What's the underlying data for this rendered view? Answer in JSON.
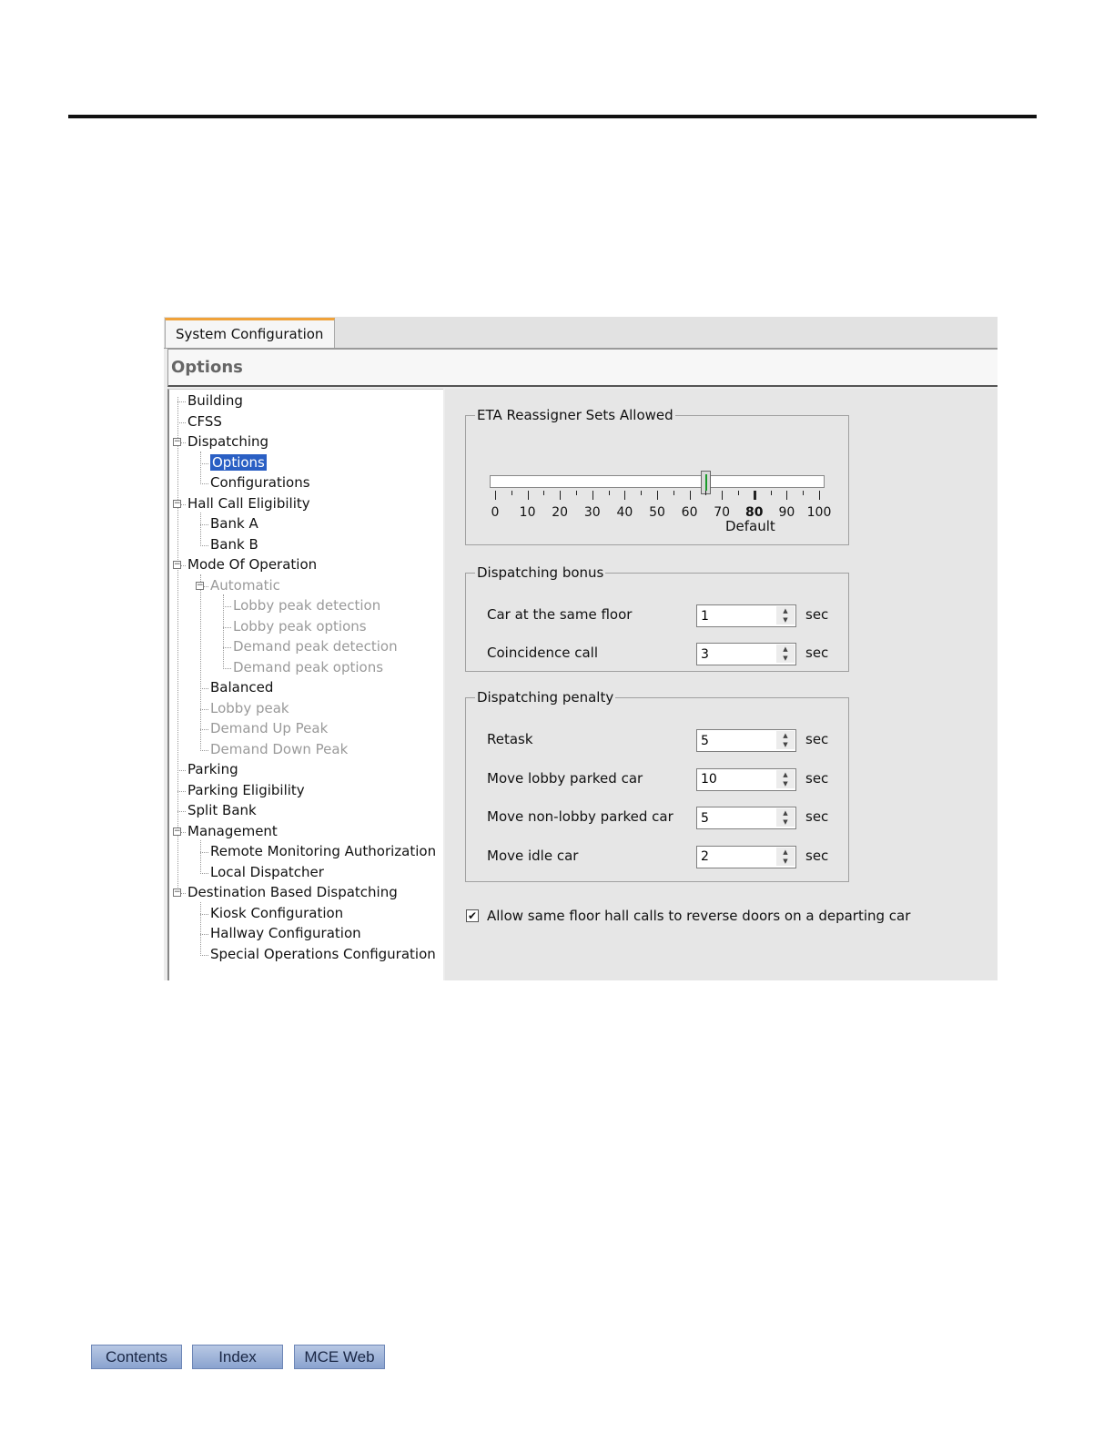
{
  "window": {
    "tab_label": "System Configuration",
    "panel_title": "Options"
  },
  "tree": [
    {
      "label": "Building",
      "level": 0,
      "expander": false,
      "dim": false
    },
    {
      "label": "CFSS",
      "level": 0,
      "expander": false,
      "dim": false
    },
    {
      "label": "Dispatching",
      "level": 0,
      "expander": true,
      "dim": false
    },
    {
      "label": "Options",
      "level": 1,
      "expander": false,
      "dim": false,
      "selected": true
    },
    {
      "label": "Configurations",
      "level": 1,
      "expander": false,
      "dim": false
    },
    {
      "label": "Hall Call Eligibility",
      "level": 0,
      "expander": true,
      "dim": false
    },
    {
      "label": "Bank A",
      "level": 1,
      "expander": false,
      "dim": false
    },
    {
      "label": "Bank B",
      "level": 1,
      "expander": false,
      "dim": false
    },
    {
      "label": "Mode Of Operation",
      "level": 0,
      "expander": true,
      "dim": false
    },
    {
      "label": "Automatic",
      "level": 1,
      "expander": true,
      "dim": true
    },
    {
      "label": "Lobby peak detection",
      "level": 2,
      "expander": false,
      "dim": true
    },
    {
      "label": "Lobby peak options",
      "level": 2,
      "expander": false,
      "dim": true
    },
    {
      "label": "Demand peak detection",
      "level": 2,
      "expander": false,
      "dim": true
    },
    {
      "label": "Demand peak options",
      "level": 2,
      "expander": false,
      "dim": true
    },
    {
      "label": "Balanced",
      "level": 1,
      "expander": false,
      "dim": false
    },
    {
      "label": "Lobby peak",
      "level": 1,
      "expander": false,
      "dim": true
    },
    {
      "label": "Demand Up Peak",
      "level": 1,
      "expander": false,
      "dim": true
    },
    {
      "label": "Demand Down Peak",
      "level": 1,
      "expander": false,
      "dim": true
    },
    {
      "label": "Parking",
      "level": 0,
      "expander": false,
      "dim": false
    },
    {
      "label": "Parking Eligibility",
      "level": 0,
      "expander": false,
      "dim": false
    },
    {
      "label": "Split Bank",
      "level": 0,
      "expander": false,
      "dim": false
    },
    {
      "label": "Management",
      "level": 0,
      "expander": true,
      "dim": false
    },
    {
      "label": "Remote Monitoring Authorization",
      "level": 1,
      "expander": false,
      "dim": false
    },
    {
      "label": "Local Dispatcher",
      "level": 1,
      "expander": false,
      "dim": false
    },
    {
      "label": "Destination Based Dispatching",
      "level": 0,
      "expander": true,
      "dim": false
    },
    {
      "label": "Kiosk Configuration",
      "level": 1,
      "expander": false,
      "dim": false
    },
    {
      "label": "Hallway Configuration",
      "level": 1,
      "expander": false,
      "dim": false
    },
    {
      "label": "Special Operations Configuration",
      "level": 1,
      "expander": false,
      "dim": false
    }
  ],
  "eta": {
    "legend": "ETA Reassigner Sets Allowed",
    "slider_value": 65,
    "slider_min": 0,
    "slider_max": 100,
    "tick_labels": [
      "0",
      "10",
      "20",
      "30",
      "40",
      "50",
      "60",
      "70",
      "80",
      "90",
      "100"
    ],
    "default_value": 80,
    "default_label": "Default"
  },
  "bonus": {
    "legend": "Dispatching bonus",
    "rows": [
      {
        "label": "Car at the same floor",
        "value": "1",
        "unit": "sec"
      },
      {
        "label": "Coincidence call",
        "value": "3",
        "unit": "sec"
      }
    ]
  },
  "penalty": {
    "legend": "Dispatching penalty",
    "rows": [
      {
        "label": "Retask",
        "value": "5",
        "unit": "sec"
      },
      {
        "label": "Move lobby parked car",
        "value": "10",
        "unit": "sec"
      },
      {
        "label": "Move non-lobby parked car",
        "value": "5",
        "unit": "sec"
      },
      {
        "label": "Move idle car",
        "value": "2",
        "unit": "sec"
      }
    ]
  },
  "reverse_doors": {
    "checked": true,
    "label": "Allow same floor hall calls to reverse doors on a departing car"
  },
  "footer": {
    "buttons": [
      "Contents",
      "Index",
      "MCE Web"
    ]
  }
}
